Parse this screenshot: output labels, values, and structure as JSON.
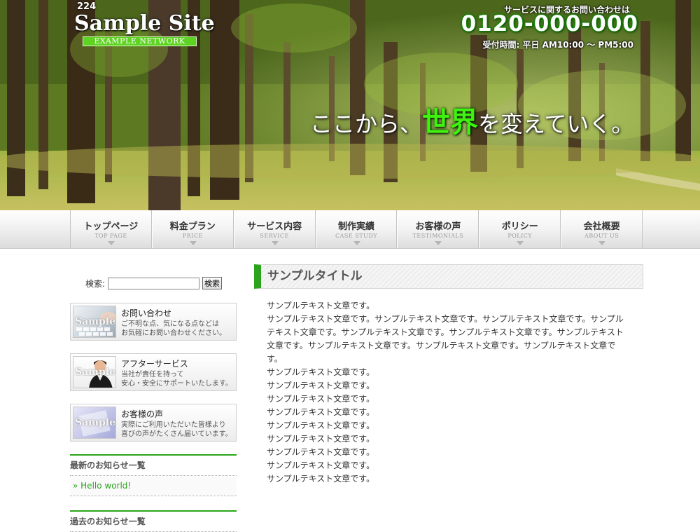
{
  "header": {
    "logo_number": "224",
    "logo_title": "Sample Site",
    "logo_subtitle": "EXAMPLE NETWORK",
    "contact_caption": "サービスに関するお問い合わせは",
    "contact_phone": "0120-000-000",
    "contact_hours": "受付時間: 平日 AM10:00 〜 PM5:00",
    "catch_before": "ここから、",
    "catch_highlight": "世界",
    "catch_after": "を変えていく。"
  },
  "nav": {
    "items": [
      {
        "label": "トップページ",
        "sub": "TOP PAGE"
      },
      {
        "label": "料金プラン",
        "sub": "PRICE"
      },
      {
        "label": "サービス内容",
        "sub": "SERVICE"
      },
      {
        "label": "制作実績",
        "sub": "CASE STUDY"
      },
      {
        "label": "お客様の声",
        "sub": "TESTIMONIALS"
      },
      {
        "label": "ポリシー",
        "sub": "POLICY"
      },
      {
        "label": "会社概要",
        "sub": "ABOUT US"
      }
    ]
  },
  "sidebar": {
    "search_label": "検索:",
    "search_value": "",
    "search_button": "検索",
    "banners": [
      {
        "thumb": "Sample",
        "title": "お問い合わせ",
        "desc1": "ご不明な点、気になる点などは",
        "desc2": "お気軽にお問い合わせください。"
      },
      {
        "thumb": "Sample",
        "title": "アフターサービス",
        "desc1": "当社が責任を持って",
        "desc2": "安心・安全にサポートいたします。"
      },
      {
        "thumb": "Sample",
        "title": "お客様の声",
        "desc1": "実際にご利用いただいた皆様より",
        "desc2": "喜びの声がたくさん届いています。"
      }
    ],
    "latest_news_title": "最新のお知らせ一覧",
    "news_items": [
      "» Hello world!"
    ],
    "past_news_title": "過去のお知らせ一覧"
  },
  "main": {
    "title": "サンプルタイトル",
    "intro": "サンプルテキスト文章です。",
    "paragraph": "サンプルテキスト文章です。サンプルテキスト文章です。サンプルテキスト文章です。サンプルテキスト文章です。サンプルテキスト文章です。サンプルテキスト文章です。サンプルテキスト文章です。サンプルテキスト文章です。サンプルテキスト文章です。サンプルテキスト文章です。",
    "lines": [
      "サンプルテキスト文章です。",
      "サンプルテキスト文章です。",
      "サンプルテキスト文章です。",
      "サンプルテキスト文章です。",
      "サンプルテキスト文章です。",
      "サンプルテキスト文章です。",
      "サンプルテキスト文章です。",
      "サンプルテキスト文章です。",
      "サンプルテキスト文章です。"
    ]
  },
  "colors": {
    "accent_green": "#2aa51b",
    "phone_glow": "#0a8a00",
    "catch_highlight": "#3ef40f"
  }
}
